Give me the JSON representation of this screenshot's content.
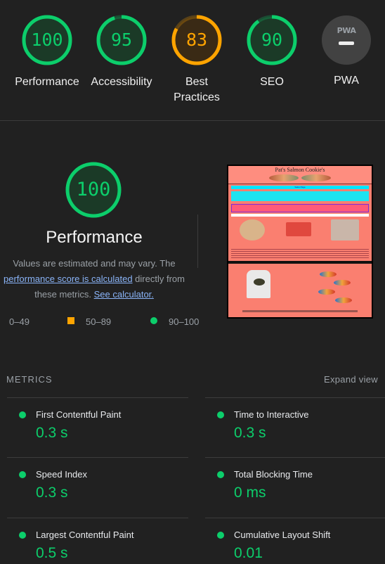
{
  "gauges": [
    {
      "score": "100",
      "label": "Performance",
      "color": "#0cce6b",
      "fraction": 1.0
    },
    {
      "score": "95",
      "label": "Accessibility",
      "color": "#0cce6b",
      "fraction": 0.95
    },
    {
      "score": "83",
      "label": "Best Practices",
      "color": "#ffa400",
      "fraction": 0.83
    },
    {
      "score": "90",
      "label": "SEO",
      "color": "#0cce6b",
      "fraction": 0.9
    }
  ],
  "pwa": {
    "badge_text": "PWA",
    "label": "PWA",
    "icon": "pwa-dash-icon"
  },
  "performance": {
    "score": "100",
    "fraction": 1.0,
    "title": "Performance",
    "desc_1": "Values are estimated and may vary. The",
    "link_score": "performance score is calculated",
    "desc_2": "directly from",
    "desc_3": "these metrics.",
    "link_calc": "See calculator."
  },
  "legend": {
    "fail": "0–49",
    "average": "50–89",
    "pass": "90–100"
  },
  "screenshot": {
    "title": "Pat's Salmon Cookie's",
    "nav": "Sales Page"
  },
  "metrics": {
    "heading": "METRICS",
    "expand": "Expand view",
    "items": [
      {
        "name": "First Contentful Paint",
        "value": "0.3 s"
      },
      {
        "name": "Time to Interactive",
        "value": "0.3 s"
      },
      {
        "name": "Speed Index",
        "value": "0.3 s"
      },
      {
        "name": "Total Blocking Time",
        "value": "0 ms"
      },
      {
        "name": "Largest Contentful Paint",
        "value": "0.5 s"
      },
      {
        "name": "Cumulative Layout Shift",
        "value": "0.01"
      }
    ]
  },
  "colors": {
    "pass": "#0cce6b",
    "average": "#ffa400",
    "fail": "#ff4e42"
  }
}
